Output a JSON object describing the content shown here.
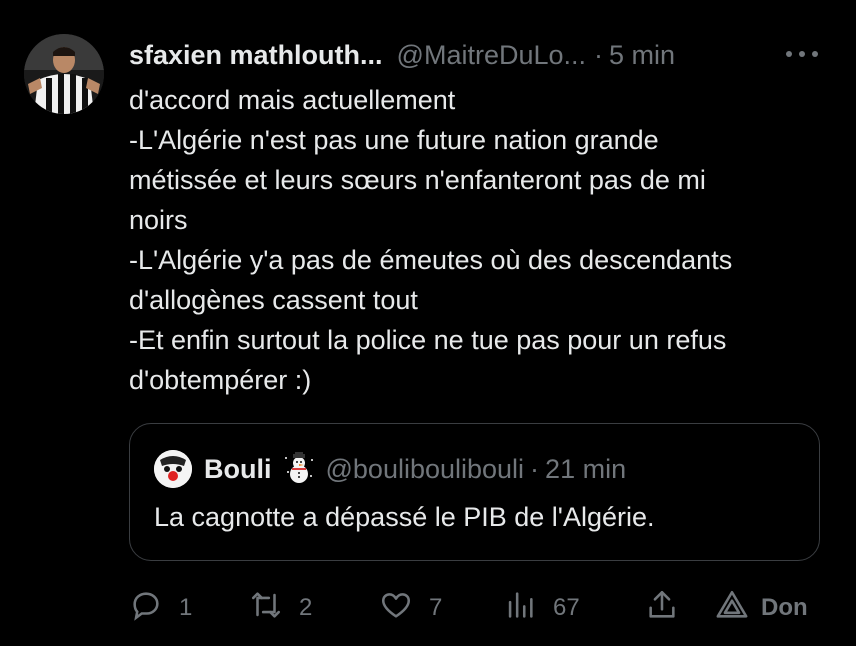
{
  "tweet": {
    "author_name": "sfaxien mathlouth...",
    "author_handle": "@MaitreDuLo...",
    "separator": "·",
    "time": "5 min",
    "text_lines": [
      "d'accord mais actuellement",
      "-L'Algérie n'est pas une future nation grande",
      "métissée et leurs sœurs n'enfanteront pas de mi",
      "noirs",
      "-L'Algérie y'a pas de émeutes où des descendants",
      "d'allogènes cassent tout",
      "-Et enfin surtout la police ne tue pas pour un refus",
      "d'obtempérer :)"
    ]
  },
  "quote": {
    "author_name": "Bouli",
    "author_emoji": "snowman-emoji",
    "author_handle": "@bouliboulibouli",
    "separator": "·",
    "time": "21 min",
    "text": "La cagnotte a dépassé le PIB de l'Algérie."
  },
  "actions": {
    "reply_count": "1",
    "retweet_count": "2",
    "like_count": "7",
    "views_count": "67",
    "share_icon": "share-icon",
    "donate_label": "Don"
  },
  "icons": {
    "reply": "comment-icon",
    "retweet": "retweet-icon",
    "like": "heart-icon",
    "views": "analytics-icon",
    "donate": "donate-icon",
    "more": "more-icon"
  },
  "colors": {
    "background": "#000000",
    "text": "#e7e9ea",
    "secondary": "#71767b",
    "border": "#3a3d41"
  }
}
